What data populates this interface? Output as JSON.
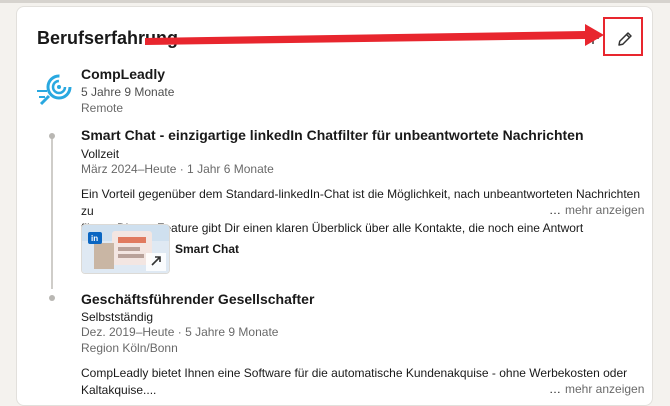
{
  "section": {
    "title": "Berufserfahrung",
    "add_icon": "plus-icon",
    "edit_icon": "pencil-icon"
  },
  "annotation": {
    "color": "#e8262e"
  },
  "company": {
    "name": "CompLeadly",
    "duration": "5 Jahre 9 Monate",
    "work_type": "Remote",
    "logo_color": "#29a8e0"
  },
  "positions": [
    {
      "title": "Smart Chat - einzigartige linkedIn Chatfilter für unbeantwortete Nachrichten",
      "employment_type": "Vollzeit",
      "date_range": "März 2024–Heute · 1 Jahr 6 Monate",
      "description_line1": "Ein Vorteil gegenüber dem Standard-linkedIn-Chat ist die Möglichkeit, nach unbeantworteten Nachrichten zu",
      "description_line2": "filtern. Dieses Feature gibt Dir einen klaren Überblick über alle Kontakte, die noch eine Antwort",
      "more_dots": "…",
      "more_label": "mehr anzeigen",
      "media": {
        "label": "Smart Chat",
        "external_icon": "external-link-icon"
      }
    },
    {
      "title": "Geschäftsführender Gesellschafter",
      "employment_type": "Selbstständig",
      "date_range": "Dez. 2019–Heute · 5 Jahre 9 Monate",
      "location": "Region Köln/Bonn",
      "description_line1": "CompLeadly bietet Ihnen eine Software für die automatische Kundenakquise - ohne Werbekosten oder",
      "description_line2": "Kaltakquise....",
      "more_dots": "…",
      "more_label": "mehr anzeigen"
    }
  ]
}
